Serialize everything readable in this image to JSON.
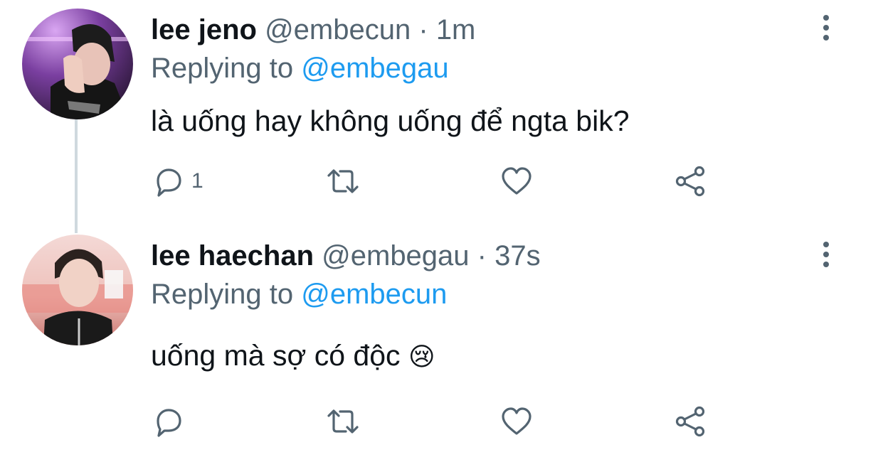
{
  "tweets": [
    {
      "display_name": "lee jeno",
      "handle": "@embecun",
      "separator": "·",
      "time": "1m",
      "replying_prefix": "Replying to",
      "replying_to": "@embegau",
      "text": "là uống hay không uống để ngta bik?",
      "reply_count": "1",
      "avatar": "profile-photo-purple"
    },
    {
      "display_name": "lee haechan",
      "handle": "@embegau",
      "separator": "·",
      "time": "37s",
      "replying_prefix": "Replying to",
      "replying_to": "@embecun",
      "text": "uống mà sợ có độc",
      "emoji": "😢",
      "avatar": "profile-photo-pink"
    }
  ],
  "icons": {
    "reply": "reply-icon",
    "retweet": "retweet-icon",
    "like": "like-icon",
    "share": "share-icon",
    "more": "more-icon"
  },
  "colors": {
    "text": "#0f1419",
    "secondary": "#536471",
    "accent": "#1d9bf0",
    "thread_line": "#cfd9de"
  }
}
